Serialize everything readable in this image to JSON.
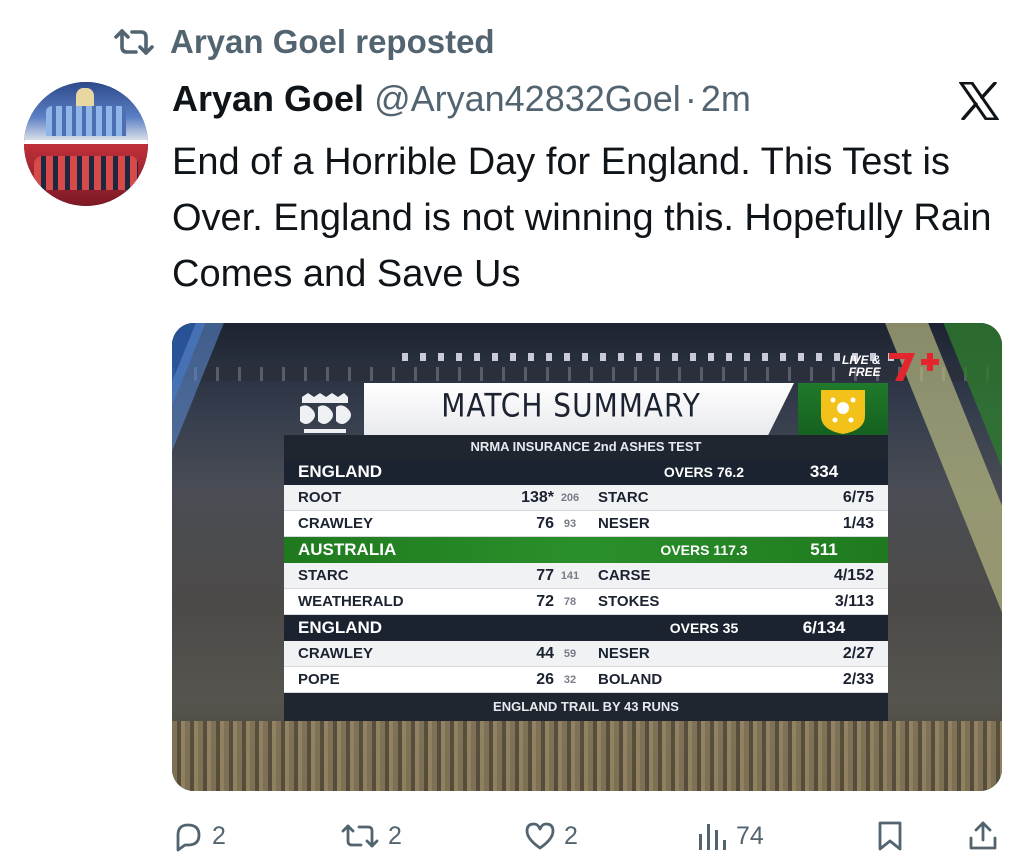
{
  "repost": {
    "text": "Aryan Goel reposted"
  },
  "post": {
    "display_name": "Aryan Goel",
    "handle": "@Aryan42832Goel",
    "separator": "·",
    "time": "2m",
    "text": "End of a Horrible Day for England. This Test is Over. England is not winning this. Hopefully Rain Comes and Save Us"
  },
  "media": {
    "badge": {
      "live_free_line1": "LIVE &",
      "live_free_line2": "FREE"
    },
    "scorecard": {
      "title": "MATCH SUMMARY",
      "subtitle": "NRMA INSURANCE 2nd ASHES TEST",
      "innings": [
        {
          "team": "ENGLAND",
          "overs": "OVERS 76.2",
          "total": "334",
          "style": "dark",
          "rows": [
            {
              "batter": "ROOT",
              "runs": "138*",
              "balls": "206",
              "bowler": "STARC",
              "figures": "6/75"
            },
            {
              "batter": "CRAWLEY",
              "runs": "76",
              "balls": "93",
              "bowler": "NESER",
              "figures": "1/43"
            }
          ]
        },
        {
          "team": "AUSTRALIA",
          "overs": "OVERS 117.3",
          "total": "511",
          "style": "green",
          "rows": [
            {
              "batter": "STARC",
              "runs": "77",
              "balls": "141",
              "bowler": "CARSE",
              "figures": "4/152"
            },
            {
              "batter": "WEATHERALD",
              "runs": "72",
              "balls": "78",
              "bowler": "STOKES",
              "figures": "3/113"
            }
          ]
        },
        {
          "team": "ENGLAND",
          "overs": "OVERS 35",
          "total": "6/134",
          "style": "dark",
          "rows": [
            {
              "batter": "CRAWLEY",
              "runs": "44",
              "balls": "59",
              "bowler": "NESER",
              "figures": "2/27"
            },
            {
              "batter": "POPE",
              "runs": "26",
              "balls": "32",
              "bowler": "BOLAND",
              "figures": "2/33"
            }
          ]
        }
      ],
      "footer": "ENGLAND TRAIL BY 43 RUNS"
    }
  },
  "actions": {
    "replies": "2",
    "reposts": "2",
    "likes": "2",
    "views": "74"
  },
  "colors": {
    "text": "#0f1419",
    "muted": "#536471",
    "england_bar": "#1b2230",
    "australia_bar": "#2a8f2a"
  }
}
